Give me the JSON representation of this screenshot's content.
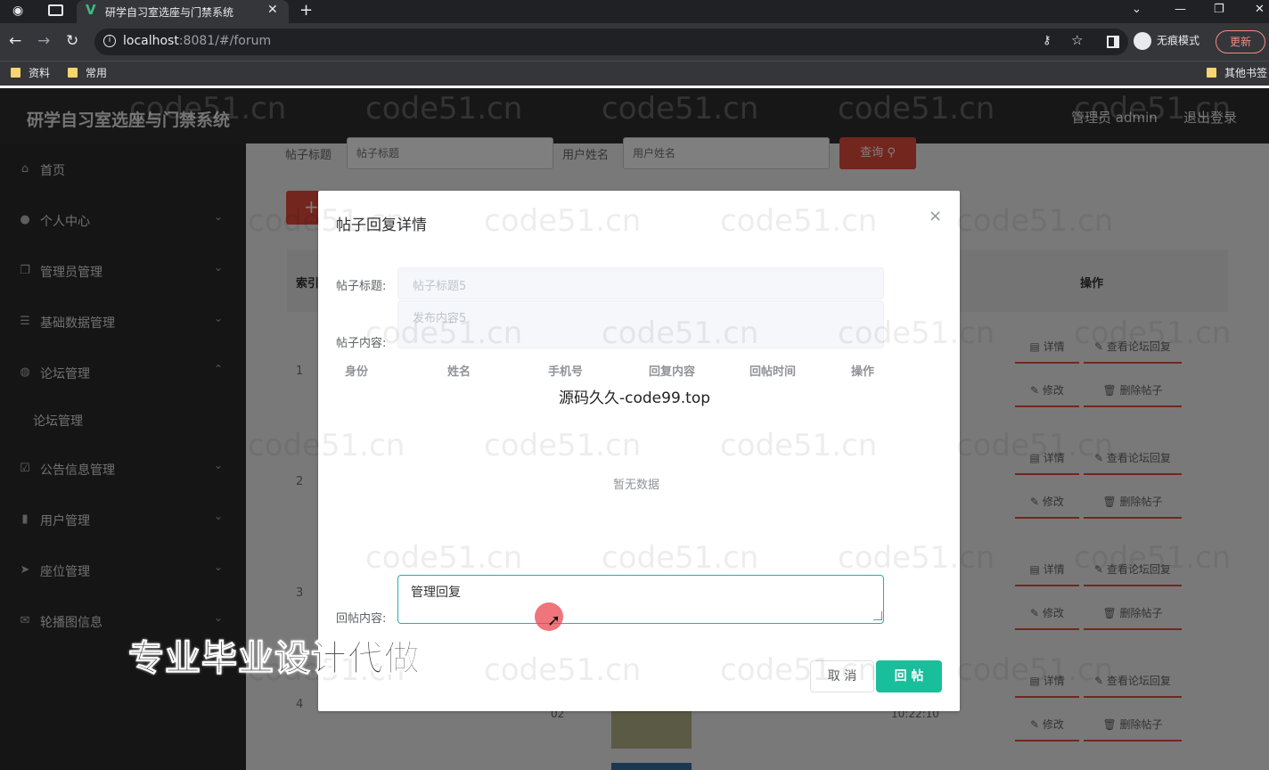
{
  "browser": {
    "tab_title": "研学自习室选座与门禁系统",
    "url_host": "localhost",
    "url_rest": ":8081/#/forum",
    "incognito_label": "无痕模式",
    "update_label": "更新",
    "bookmarks": [
      "资料",
      "常用"
    ],
    "other_bookmarks": "其他书签"
  },
  "header": {
    "brand": "研学自习室选座与门禁系统",
    "user": "管理员 admin",
    "logout": "退出登录"
  },
  "sidebar": {
    "items": [
      {
        "label": "首页",
        "icon": "home-icon"
      },
      {
        "label": "个人中心",
        "icon": "user-icon"
      },
      {
        "label": "管理员管理",
        "icon": "copy-icon"
      },
      {
        "label": "基础数据管理",
        "icon": "list-icon"
      },
      {
        "label": "论坛管理",
        "icon": "location-icon"
      },
      {
        "label": "论坛管理",
        "icon": ""
      },
      {
        "label": "公告信息管理",
        "icon": "check-square-icon"
      },
      {
        "label": "用户管理",
        "icon": "bar-chart-icon"
      },
      {
        "label": "座位管理",
        "icon": "send-icon"
      },
      {
        "label": "轮播图信息",
        "icon": "mail-icon"
      }
    ]
  },
  "filters": {
    "title_label": "帖子标题",
    "title_placeholder": "帖子标题",
    "user_label": "用户姓名",
    "user_placeholder": "用户姓名",
    "search_label": "查询"
  },
  "table": {
    "index_header": "索引",
    "ops_header": "操作",
    "rows": [
      "1",
      "2",
      "3",
      "4"
    ],
    "ops": {
      "detail": "详情",
      "view_replies": "查看论坛回复",
      "edit": "修改",
      "delete": "删除帖子"
    },
    "row4_user": "02",
    "row4_time": "10:22:10"
  },
  "dialog": {
    "title": "帖子回复详情",
    "post_title_label": "帖子标题:",
    "post_title_value": "帖子标题5",
    "post_content_label": "帖子内容:",
    "post_content_value": "发布内容5",
    "columns": [
      "身份",
      "姓名",
      "手机号",
      "回复内容",
      "回帖时间",
      "操作"
    ],
    "empty_text": "暂无数据",
    "reply_label": "回帖内容:",
    "reply_value": "管理回复",
    "cancel": "取 消",
    "submit": "回 帖"
  },
  "overlay": {
    "source_mark": "源码久久-code99.top",
    "watermark": "code51.cn",
    "promo": "专业毕业设计代做"
  },
  "colors": {
    "accent_red": "#e74c3c",
    "submit_green": "#19be9b",
    "header_bg": "#2f2f2f",
    "sidebar_bg": "#2a2a2a"
  }
}
